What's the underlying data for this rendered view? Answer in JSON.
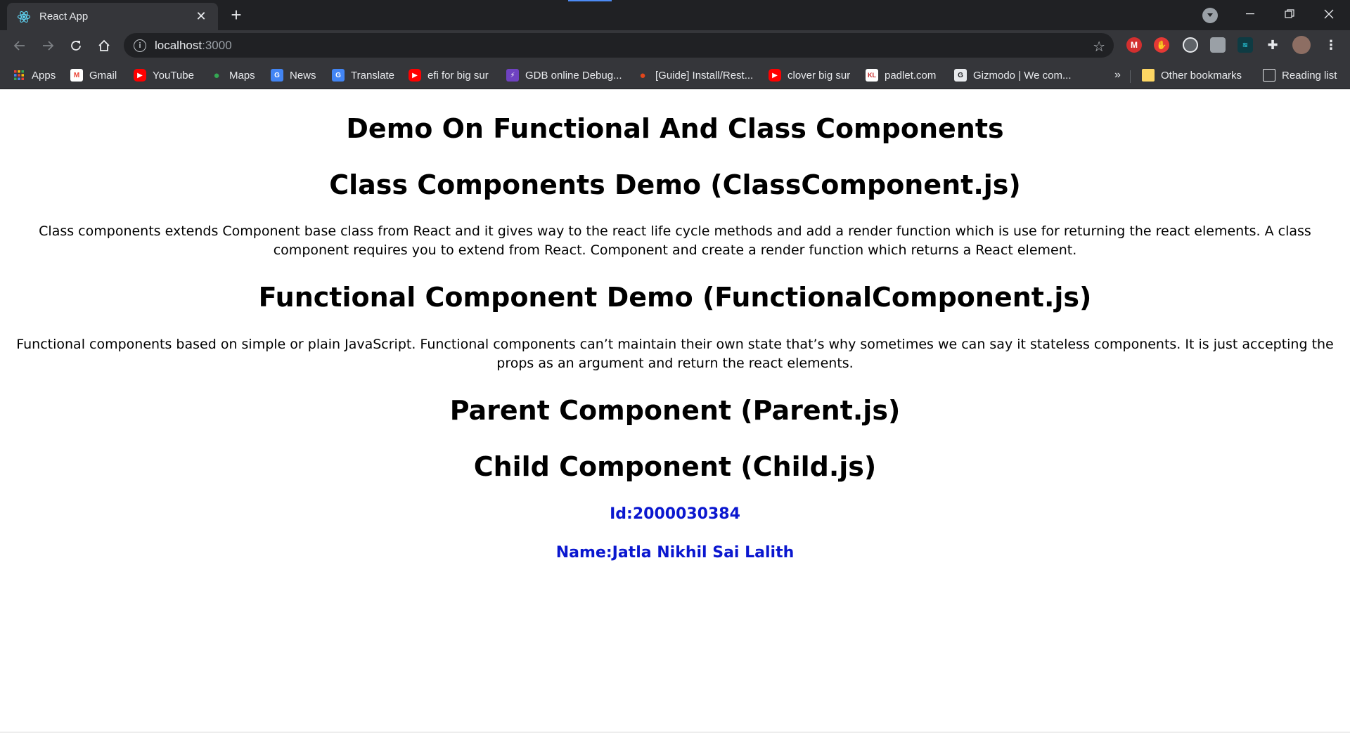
{
  "browser": {
    "tab": {
      "title": "React App"
    },
    "url": {
      "host": "localhost",
      "port": ":3000"
    },
    "bookmarks": [
      {
        "label": "Apps",
        "icon": "apps-grid-icon",
        "color": "#ea4335"
      },
      {
        "label": "Gmail",
        "icon": "gmail-icon",
        "color": "#ea4335"
      },
      {
        "label": "YouTube",
        "icon": "youtube-icon",
        "color": "#ff0000"
      },
      {
        "label": "Maps",
        "icon": "maps-icon",
        "color": "#34a853"
      },
      {
        "label": "News",
        "icon": "news-icon",
        "color": "#4285f4"
      },
      {
        "label": "Translate",
        "icon": "translate-icon",
        "color": "#4285f4"
      },
      {
        "label": "efi for big sur",
        "icon": "youtube-icon",
        "color": "#ff0000"
      },
      {
        "label": "GDB online Debug...",
        "icon": "gdb-icon",
        "color": "#6f42c1"
      },
      {
        "label": "[Guide] Install/Rest...",
        "icon": "apple-icon",
        "color": "#e2461b"
      },
      {
        "label": "clover big sur",
        "icon": "youtube-icon",
        "color": "#ff0000"
      },
      {
        "label": "padlet.com",
        "icon": "padlet-icon",
        "color": "#c62828"
      },
      {
        "label": "Gizmodo | We com...",
        "icon": "gizmodo-icon",
        "color": "#5f6368"
      }
    ],
    "overflow_label": "»",
    "other_bookmarks": "Other bookmarks",
    "reading_list": "Reading list"
  },
  "page": {
    "title": "Demo On Functional And Class Components",
    "class_heading": "Class Components Demo (ClassComponent.js)",
    "class_text": "Class components extends Component base class from React and it gives way to the react life cycle methods and add a render function which is use for returning the react elements. A class component requires you to extend from React. Component and create a render function which returns a React element.",
    "functional_heading": "Functional Component Demo (FunctionalComponent.js)",
    "functional_text": "Functional components based on simple or plain JavaScript. Functional components can’t maintain their own state that’s why sometimes we can say it stateless components. It is just accepting the props as an argument and return the react elements.",
    "parent_heading": "Parent Component (Parent.js)",
    "child_heading": "Child Component (Child.js)",
    "child_id": "Id:2000030384",
    "child_name": "Name:Jatla Nikhil Sai Lalith",
    "accent_color": "#0a17cf"
  }
}
